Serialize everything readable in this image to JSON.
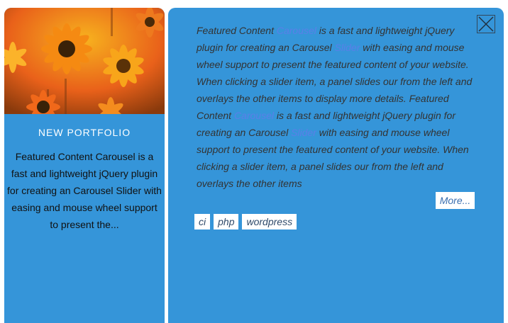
{
  "card": {
    "image_alt": "orange and yellow daisy flowers",
    "title": "NEW PORTFOLIO",
    "excerpt": "Featured Content Carousel is a fast and lightweight jQuery plugin for creating an Carousel Slider with easing and mouse wheel support to present the..."
  },
  "panel": {
    "description_segments": [
      {
        "text": "Featured Content ",
        "link": false
      },
      {
        "text": "Carousel",
        "link": true
      },
      {
        "text": " is a fast and lightweight jQuery plugin for creating an Carousel ",
        "link": false
      },
      {
        "text": "Slider",
        "link": true
      },
      {
        "text": " with easing and mouse wheel support to present the featured content of your website. When clicking a slider item, a panel slides our from the left and overlays the other items to display more details. Featured Content ",
        "link": false
      },
      {
        "text": "Carousel",
        "link": true
      },
      {
        "text": " is a fast and lightweight jQuery plugin for creating an Carousel ",
        "link": false
      },
      {
        "text": "Slider",
        "link": true
      },
      {
        "text": " with easing and mouse wheel support to present the featured content of your website. When clicking a slider item, a panel slides our from the left and overlays the other items",
        "link": false
      }
    ],
    "more_label": "More...",
    "tags": [
      "ci",
      "php",
      "wordpress"
    ],
    "close_icon": "close-icon"
  },
  "colors": {
    "panel_bg": "#3595d9",
    "body_text": "#333333",
    "link_text": "#5a7fe8",
    "card_title": "#ffffff"
  }
}
